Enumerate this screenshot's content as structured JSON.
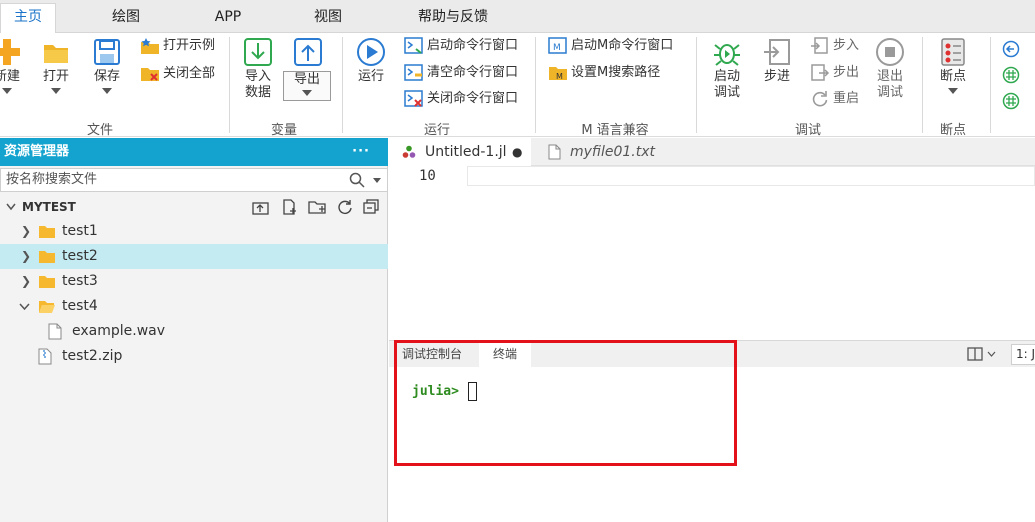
{
  "menu": {
    "tabs": [
      "主页",
      "绘图",
      "APP",
      "视图",
      "帮助与反馈"
    ]
  },
  "ribbon": {
    "new_label": "新建",
    "open_label": "打开",
    "save_label": "保存",
    "open_example_label": "打开示例",
    "close_all_label": "关闭全部",
    "file_group": "文件",
    "import_label_1": "导入",
    "import_label_2": "数据",
    "export_label": "导出",
    "variable_group": "变量",
    "run_label": "运行",
    "start_cmd_label": "启动命令行窗口",
    "clear_cmd_label": "清空命令行窗口",
    "close_cmd_label": "关闭命令行窗口",
    "run_group": "运行",
    "start_m_label": "启动M命令行窗口",
    "set_m_path_label": "设置M搜索路径",
    "m_group": "M 语言兼容",
    "start_debug_1": "启动",
    "start_debug_2": "调试",
    "step_label": "步进",
    "step_in_label": "步入",
    "step_out_label": "步出",
    "restart_label": "重启",
    "exit_debug_1": "退出",
    "exit_debug_2": "调试",
    "debug_group": "调试",
    "breakpoint_label": "断点",
    "breakpoint_group": "断点"
  },
  "explorer": {
    "title": "资源管理器",
    "more": "···",
    "search_placeholder": "按名称搜索文件",
    "root": "MYTEST",
    "items": [
      {
        "label": "test1",
        "type": "folder"
      },
      {
        "label": "test2",
        "type": "folder",
        "selected": true
      },
      {
        "label": "test3",
        "type": "folder"
      },
      {
        "label": "test4",
        "type": "folder-open"
      },
      {
        "label": "example.wav",
        "type": "file"
      },
      {
        "label": "test2.zip",
        "type": "zip"
      }
    ]
  },
  "editor": {
    "tabs": [
      {
        "label": "Untitled-1.jl",
        "modified": "●"
      },
      {
        "label": "myfile01.txt"
      }
    ],
    "line_number": "10"
  },
  "panel": {
    "tabs": [
      "调试控制台",
      "终端"
    ],
    "active_tab": "终端",
    "right_label": "1: J"
  },
  "terminal": {
    "prompt": "julia>"
  },
  "colors": {
    "accent": "#1a73c9",
    "explorer_header": "#14a3cf",
    "selection": "#c5ebf2",
    "prompt": "#2e8b20",
    "highlight_box": "#e3121a"
  }
}
